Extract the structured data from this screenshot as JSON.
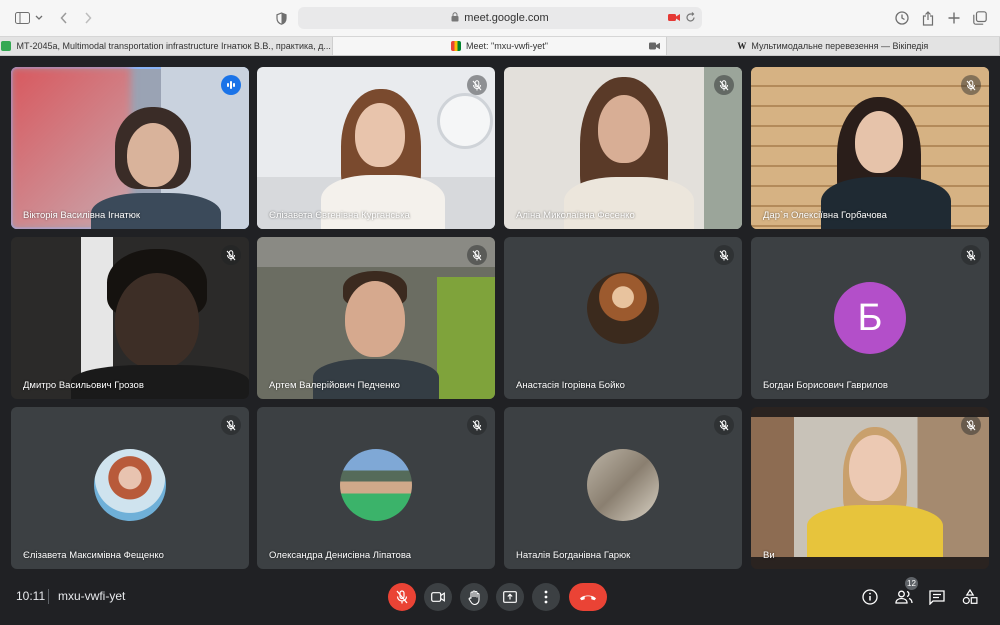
{
  "browser": {
    "url": "meet.google.com",
    "tabs": [
      {
        "title": "МТ-2045а, Multimodal transportation infrastructure Ігнатюк В.В., практика, д...",
        "favicon_color": "#34a853"
      },
      {
        "title": "Meet: \"mxu-vwfi-yet\"",
        "favicon_color": "#00832d"
      },
      {
        "title": "Мультимодальне перевезення — Вікіпедія",
        "favicon_color": "#222222"
      }
    ]
  },
  "participants": [
    {
      "name": "Вікторія Василівна Ігнатюк",
      "type": "video",
      "speaking": true
    },
    {
      "name": "Єлізавета Євгенівна Курганська",
      "type": "video",
      "muted": true
    },
    {
      "name": "Аліна Миколаївна Фесенко",
      "type": "video",
      "muted": true
    },
    {
      "name": "Дар`я Олексіївна Горбачова",
      "type": "video",
      "muted": true
    },
    {
      "name": "Дмитро Васильович Грозов",
      "type": "video",
      "muted": true
    },
    {
      "name": "Артем Валерійович Педченко",
      "type": "video",
      "muted": true
    },
    {
      "name": "Анастасія Ігорівна Бойко",
      "type": "avatar-photo",
      "muted": true
    },
    {
      "name": "Богдан Борисович Гаврилов",
      "type": "avatar-letter",
      "letter": "Б",
      "muted": true
    },
    {
      "name": "Єлізавета Максимівна Фещенко",
      "type": "avatar-photo",
      "muted": true
    },
    {
      "name": "Олександра Денисівна Ліпатова",
      "type": "avatar-photo",
      "muted": true
    },
    {
      "name": "Наталія Богданівна Гарюк",
      "type": "avatar-photo",
      "muted": true
    },
    {
      "name": "Ви",
      "type": "video",
      "muted": true
    }
  ],
  "bottom": {
    "time": "10:11",
    "meeting_code": "mxu-vwfi-yet",
    "participant_count": "12"
  },
  "colors": {
    "background": "#202124",
    "tile": "#3c4043",
    "accent": "#8ab4f8",
    "danger": "#ea4335",
    "avatar_letter_bg": "#b34fc9"
  }
}
